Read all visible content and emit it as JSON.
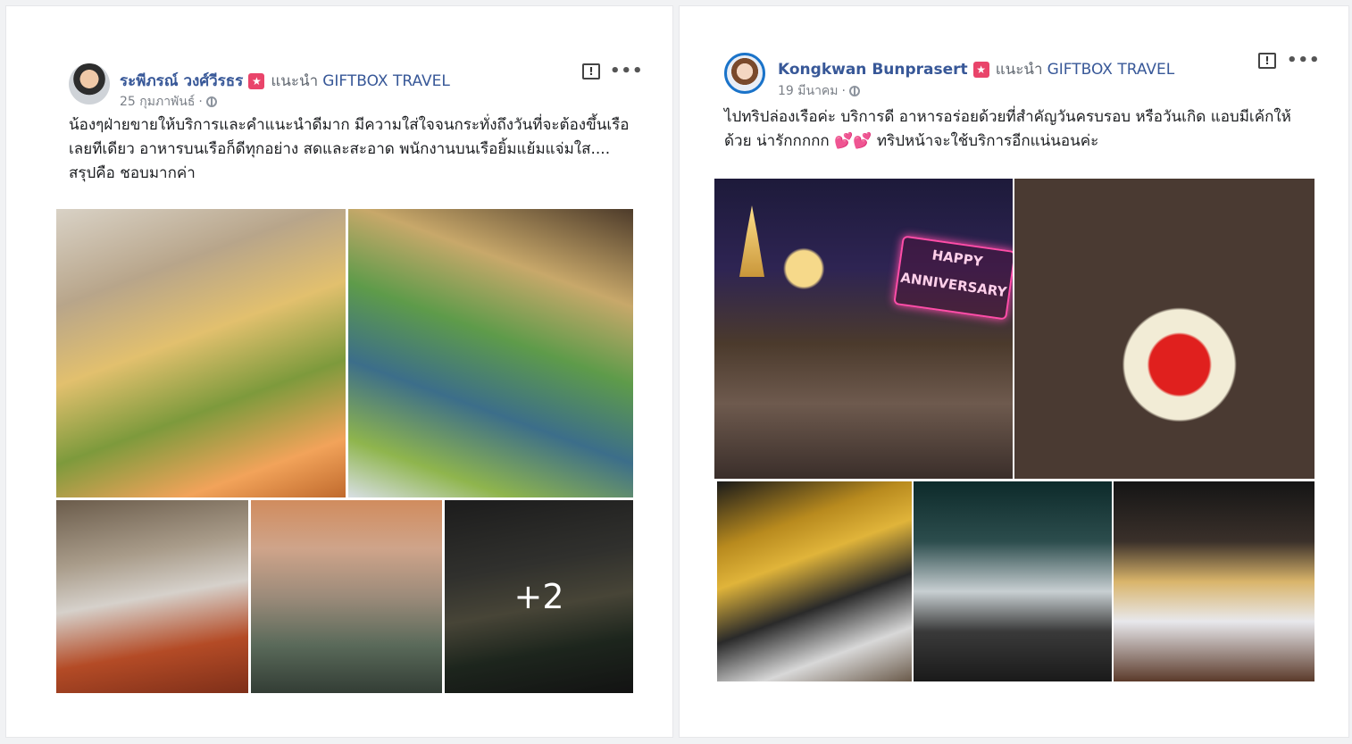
{
  "posts": [
    {
      "author": "ระพีภรณ์ วงศ์วีรธร",
      "badge_icon": "recommend-star-icon",
      "recommends_label": "แนะนำ",
      "page_name": "GIFTBOX TRAVEL",
      "date": "25 กุมภาพันธ์",
      "separator": "·",
      "text": "น้องๆฝ่ายขายให้บริการและคำแนะนำดีมาก มีความใส่ใจจนกระทั่งถึงวันที่จะต้องขึ้นเรือเลยทีเดียว อาหารบนเรือก็ดีทุกอย่าง สดและสะอาด พนักงานบนเรือยิ้มแย้มแจ่มใส.... สรุปคือ ชอบมากค่า",
      "more_photos_label": "+2"
    },
    {
      "author": "Kongkwan Bunprasert",
      "badge_icon": "recommend-star-icon",
      "recommends_label": "แนะนำ",
      "page_name": "GIFTBOX TRAVEL",
      "date": "19 มีนาคม",
      "separator": "·",
      "text": "ไปทริปล่องเรือค่ะ บริการดี อาหารอร่อยด้วยที่สำคัญวันครบรอบ หรือวันเกิด แอบมีเค้กให้ด้วย น่ารักกกกก 💕💕 ทริปหน้าจะใช้บริการอีกแน่นอนค่ะ",
      "sign_text": "HAPPY ANNIVERSARY"
    }
  ],
  "icons": {
    "report": "!",
    "more": "•••",
    "badge": "★"
  },
  "colors": {
    "author_link": "#385898",
    "badge": "#e9446a",
    "meta_text": "#7a7f87"
  }
}
